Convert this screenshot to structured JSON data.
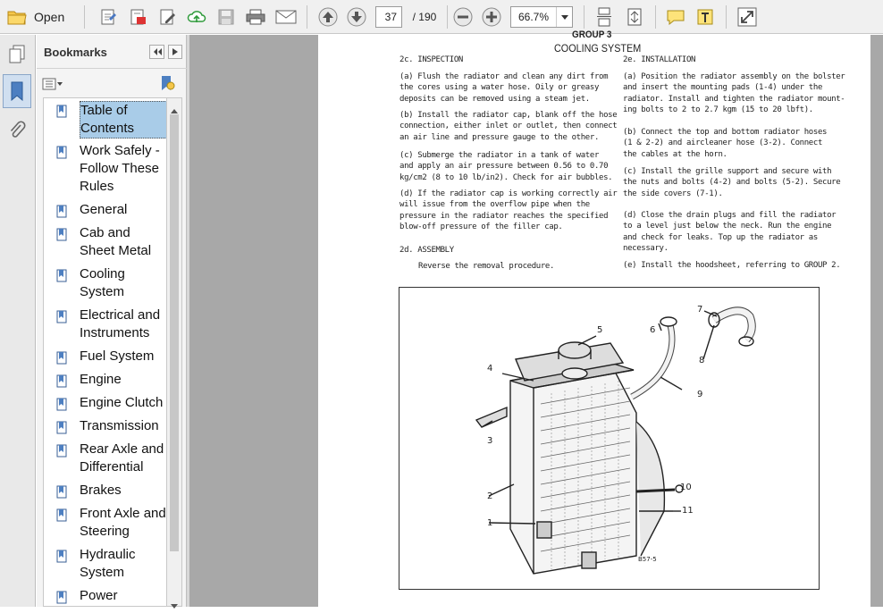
{
  "toolbar": {
    "open_label": "Open",
    "page_current": "37",
    "page_total": "/ 190",
    "zoom": "66.7%"
  },
  "sidebar": {
    "title": "Bookmarks",
    "items": [
      {
        "label": "Table of Contents"
      },
      {
        "label": "Work Safely - Follow These Rules"
      },
      {
        "label": "General"
      },
      {
        "label": "Cab and Sheet Metal"
      },
      {
        "label": "Cooling System"
      },
      {
        "label": "Electrical and Instruments"
      },
      {
        "label": "Fuel System"
      },
      {
        "label": "Engine"
      },
      {
        "label": "Engine Clutch"
      },
      {
        "label": "Transmission"
      },
      {
        "label": "Rear Axle and Differential"
      },
      {
        "label": "Brakes"
      },
      {
        "label": "Front Axle and Steering"
      },
      {
        "label": "Hydraulic System"
      },
      {
        "label": "Power"
      }
    ]
  },
  "document": {
    "group": "GROUP 3",
    "title": "COOLING SYSTEM",
    "left": {
      "h1": "2c.  INSPECTION",
      "a": [
        "(a)  Flush the radiator and clean any dirt from",
        "the cores using a water hose.  Oily or greasy",
        "deposits can be removed using a steam jet."
      ],
      "b": [
        "(b)  Install the radiator cap, blank off the hose",
        "connection, either inlet or outlet, then connect",
        "an air line and pressure gauge to the other."
      ],
      "c": [
        "(c)  Submerge the radiator in a tank of water",
        "and apply an air pressure between 0.56 to 0.70",
        "kg/cm2 (8 to 10 lb/in2).  Check for air bubbles."
      ],
      "d": [
        "(d)  If the radiator cap is working correctly air",
        "will issue from the overflow pipe when the",
        "pressure in the radiator reaches the specified",
        "blow-off pressure of the filler cap."
      ],
      "h2": "2d.  ASSEMBLY",
      "assembly": "Reverse the removal procedure."
    },
    "right": {
      "h1": "2e.  INSTALLATION",
      "a": [
        "(a)  Position the radiator assembly on the bolster",
        "and insert the mounting pads (1-4) under the",
        "radiator.  Install and tighten the radiator mount-",
        "ing bolts to 2 to 2.7 kgm (15 to 20 lbft)."
      ],
      "b": [
        "(b)  Connect the top and bottom radiator hoses",
        "(1 & 2-2) and aircleaner hose (3-2).  Connect",
        "the cables at the horn."
      ],
      "c": [
        "(c)  Install the grille support and secure with",
        "the nuts and bolts (4-2) and bolts (5-2).  Secure",
        "the side covers (7-1)."
      ],
      "d": [
        "(d)  Close the drain plugs and fill the radiator",
        "to a level just below the neck.  Run the engine",
        "and check for leaks.  Top up the radiator as",
        "necessary."
      ],
      "e": "(e)  Install the hoodsheet, referring to GROUP 2."
    },
    "figure": {
      "callouts": [
        "1",
        "2",
        "3",
        "4",
        "5",
        "6",
        "7",
        "8",
        "9",
        "10",
        "11"
      ],
      "code": "B57-5"
    }
  }
}
